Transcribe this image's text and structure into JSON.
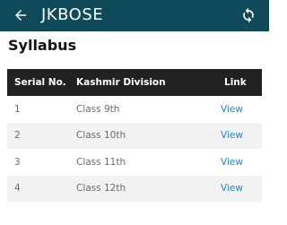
{
  "appbar": {
    "title": "JKBOSE",
    "back_icon": "arrow-left-icon",
    "refresh_icon": "refresh-icon"
  },
  "page": {
    "heading": "Syllabus"
  },
  "table": {
    "headers": [
      "Serial No.",
      "Kashmir Division",
      "Link"
    ],
    "rows": [
      {
        "serial": "1",
        "class": "Class 9th",
        "link": "View"
      },
      {
        "serial": "2",
        "class": "Class 10th",
        "link": "View"
      },
      {
        "serial": "3",
        "class": "Class 11th",
        "link": "View"
      },
      {
        "serial": "4",
        "class": "Class 12th",
        "link": "View"
      }
    ]
  },
  "colors": {
    "appbar": "#0e4a59",
    "table_header": "#212121",
    "link": "#1e88c8"
  }
}
